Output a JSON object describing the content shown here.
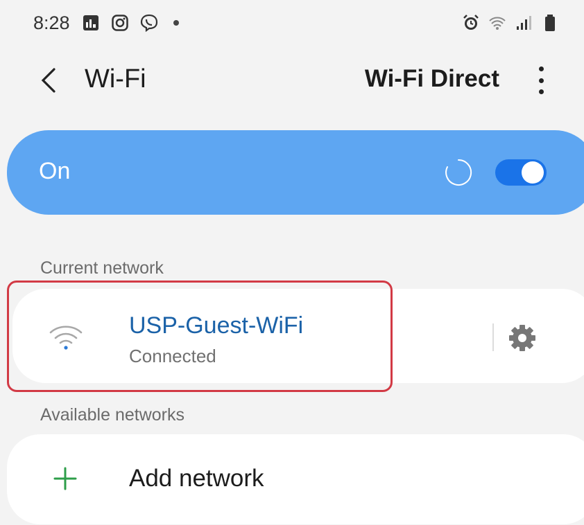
{
  "status_bar": {
    "time": "8:28",
    "left_icons": [
      "news-icon",
      "instagram-icon",
      "viber-icon",
      "notification-dot"
    ],
    "right_icons": [
      "alarm-icon",
      "wifi-icon",
      "signal-icon",
      "battery-icon"
    ]
  },
  "header": {
    "title": "Wi-Fi",
    "wifi_direct_label": "Wi-Fi Direct"
  },
  "toggle": {
    "label": "On",
    "enabled": true
  },
  "current_network": {
    "section_label": "Current network",
    "name": "USP-Guest-WiFi",
    "status": "Connected"
  },
  "available_networks": {
    "section_label": "Available networks",
    "add_label": "Add network"
  },
  "colors": {
    "accent": "#5ea6f2",
    "network_name": "#1b62a8",
    "highlight": "#d23a45",
    "add_plus": "#2e9e4a"
  }
}
